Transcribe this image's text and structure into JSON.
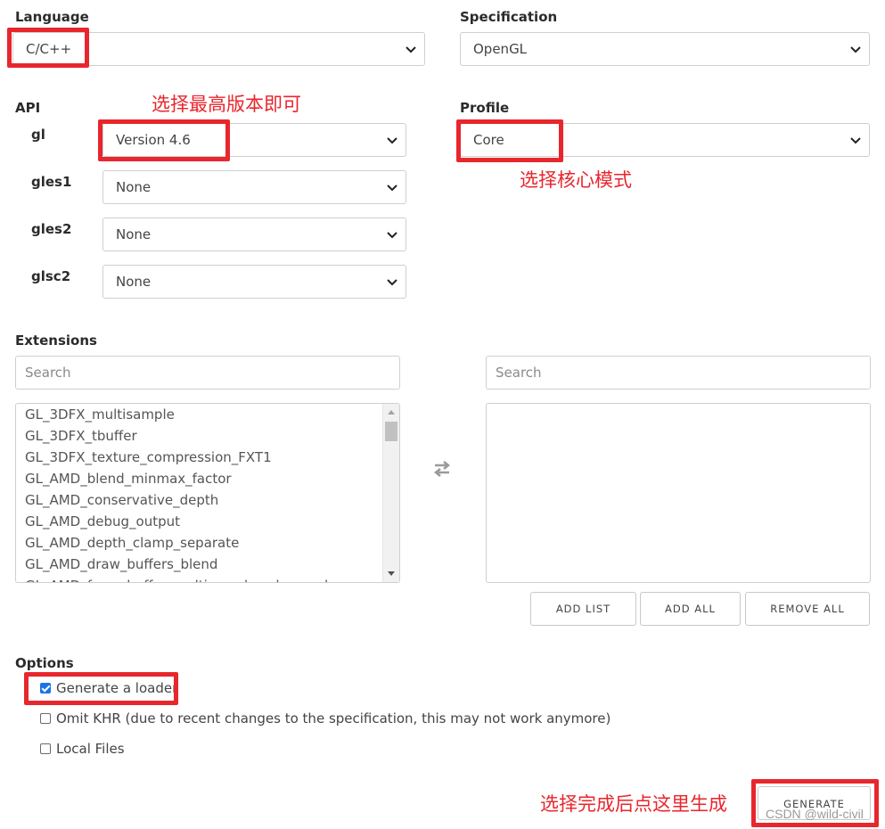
{
  "language": {
    "label": "Language",
    "value": "C/C++"
  },
  "specification": {
    "label": "Specification",
    "value": "OpenGL"
  },
  "api": {
    "label": "API",
    "rows": [
      {
        "name": "gl",
        "value": "Version 4.6"
      },
      {
        "name": "gles1",
        "value": "None"
      },
      {
        "name": "gles2",
        "value": "None"
      },
      {
        "name": "glsc2",
        "value": "None"
      }
    ]
  },
  "profile": {
    "label": "Profile",
    "value": "Core"
  },
  "annotations": {
    "api_note": "选择最高版本即可",
    "profile_note": "选择核心模式",
    "generate_note": "选择完成后点这里生成"
  },
  "extensions": {
    "label": "Extensions",
    "left_search_placeholder": "Search",
    "right_search_placeholder": "Search",
    "items": [
      "GL_3DFX_multisample",
      "GL_3DFX_tbuffer",
      "GL_3DFX_texture_compression_FXT1",
      "GL_AMD_blend_minmax_factor",
      "GL_AMD_conservative_depth",
      "GL_AMD_debug_output",
      "GL_AMD_depth_clamp_separate",
      "GL_AMD_draw_buffers_blend",
      "GL_AMD_framebuffer_multisample_advanced"
    ],
    "buttons": {
      "add_list": "ADD LIST",
      "add_all": "ADD ALL",
      "remove_all": "REMOVE ALL"
    }
  },
  "options": {
    "label": "Options",
    "items": [
      {
        "label": "Generate a loader",
        "checked": true
      },
      {
        "label": "Omit KHR (due to recent changes to the specification, this may not work anymore)",
        "checked": false
      },
      {
        "label": "Local Files",
        "checked": false
      }
    ]
  },
  "generate_label": "GENERATE",
  "watermark": "CSDN @wild-civil",
  "colors": {
    "annotation_red": "#e8262d",
    "checkbox_blue": "#1a73e8"
  },
  "icons": {
    "select_arrow": "chevron-down-icon",
    "swap": "swap-arrows-icon"
  }
}
